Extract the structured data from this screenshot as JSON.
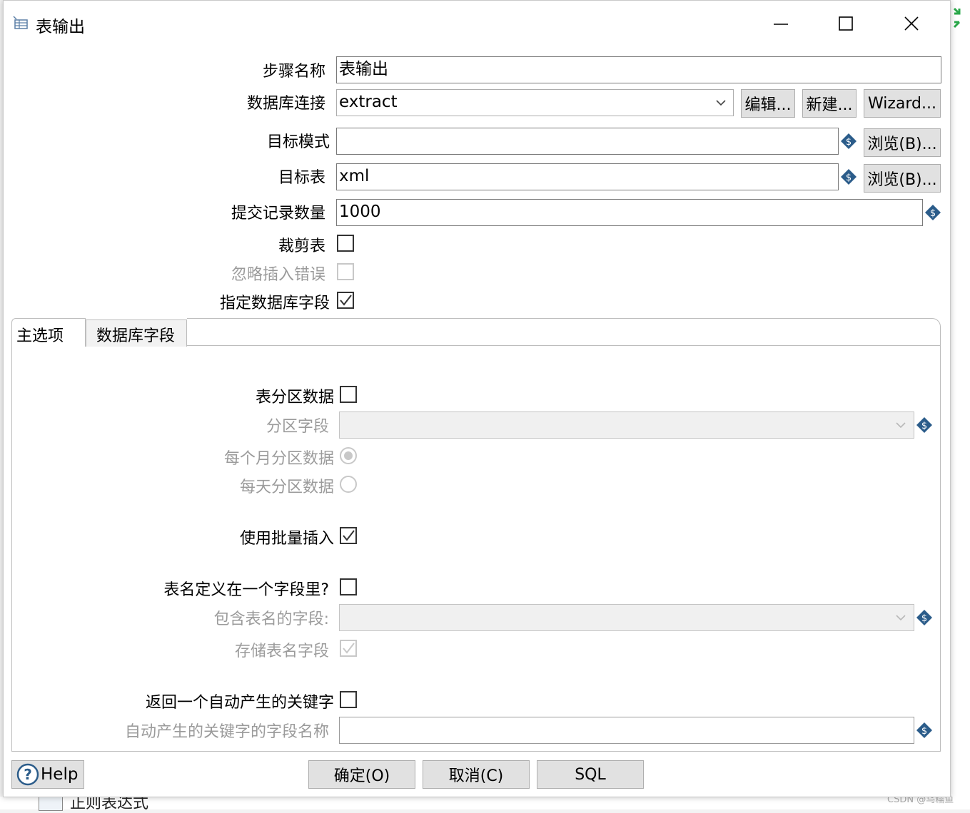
{
  "window": {
    "title": "表输出",
    "icons": {
      "app": "table-output-icon",
      "minimize": "minimize-icon",
      "maximize": "maximize-icon",
      "close": "close-icon"
    }
  },
  "form": {
    "step_name": {
      "label": "步骤名称",
      "value": "表输出"
    },
    "db_connection": {
      "label": "数据库连接",
      "value": "extract",
      "edit_button": "编辑...",
      "new_button": "新建...",
      "wizard_button": "Wizard..."
    },
    "target_schema": {
      "label": "目标模式",
      "value": "",
      "browse_button": "浏览(B)..."
    },
    "target_table": {
      "label": "目标表",
      "value": "xml",
      "browse_button": "浏览(B)..."
    },
    "commit_size": {
      "label": "提交记录数量",
      "value": "1000"
    },
    "truncate_table": {
      "label": "裁剪表",
      "checked": false
    },
    "ignore_insert_errors": {
      "label": "忽略插入错误",
      "checked": false,
      "disabled": true
    },
    "specify_db_fields": {
      "label": "指定数据库字段",
      "checked": true
    }
  },
  "tabs": [
    {
      "label": "主选项",
      "active": true
    },
    {
      "label": "数据库字段",
      "active": false
    }
  ],
  "main_tab": {
    "partition_data": {
      "label": "表分区数据",
      "checked": false
    },
    "partition_field": {
      "label": "分区字段",
      "value": "",
      "disabled": true
    },
    "partition_monthly": {
      "label": "每个月分区数据",
      "selected": true,
      "disabled": true
    },
    "partition_daily": {
      "label": "每天分区数据",
      "selected": false,
      "disabled": true
    },
    "use_batch_insert": {
      "label": "使用批量插入",
      "checked": true
    },
    "table_name_in_field": {
      "label": "表名定义在一个字段里?",
      "checked": false
    },
    "table_name_field": {
      "label": "包含表名的字段:",
      "value": "",
      "disabled": true
    },
    "store_table_name_field": {
      "label": "存储表名字段",
      "checked": true,
      "disabled": true
    },
    "return_auto_key": {
      "label": "返回一个自动产生的关键字",
      "checked": false
    },
    "auto_key_field_name": {
      "label": "自动产生的关键字的字段名称",
      "value": ""
    }
  },
  "footer": {
    "help_button": "Help",
    "ok_button": "确定(O)",
    "cancel_button": "取消(C)",
    "sql_button": "SQL"
  },
  "background": {
    "regex_item": "正则表达式",
    "watermark": "CSDN @乌糯鱼"
  },
  "colors": {
    "window_bg": "#ffffff",
    "button_bg": "#e1e1e1",
    "disabled_text": "#9b9b9b",
    "variable_icon": "#2b5c8a"
  }
}
